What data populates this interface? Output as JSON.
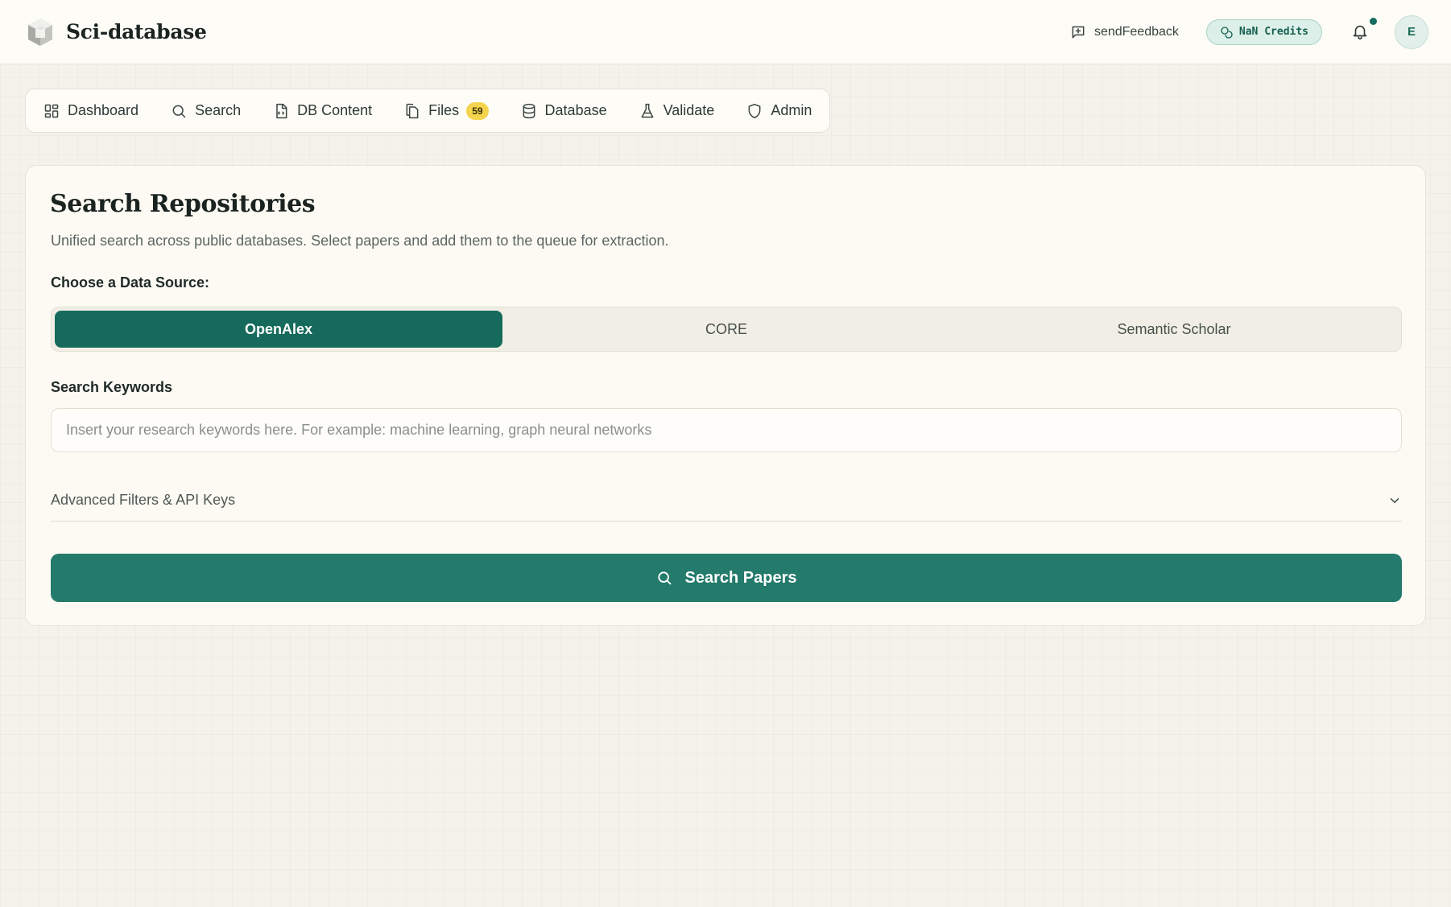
{
  "header": {
    "brand_name": "Sci-database",
    "feedback_label": "sendFeedback",
    "credits_label": "NaN Credits",
    "avatar_initial": "E"
  },
  "nav": {
    "items": [
      {
        "label": "Dashboard",
        "icon": "dashboard-icon"
      },
      {
        "label": "Search",
        "icon": "search-icon"
      },
      {
        "label": "DB Content",
        "icon": "file-code-icon"
      },
      {
        "label": "Files",
        "icon": "files-icon",
        "badge": "59"
      },
      {
        "label": "Database",
        "icon": "database-icon"
      },
      {
        "label": "Validate",
        "icon": "flask-icon"
      },
      {
        "label": "Admin",
        "icon": "shield-icon"
      }
    ]
  },
  "main": {
    "title": "Search Repositories",
    "description": "Unified search across public databases. Select papers and add them to the queue for extraction.",
    "source_label": "Choose a Data Source:",
    "sources": [
      "OpenAlex",
      "CORE",
      "Semantic Scholar"
    ],
    "selected_source": "OpenAlex",
    "keywords_label": "Search Keywords",
    "keywords_value": "",
    "keywords_placeholder": "Insert your research keywords here. For example: machine learning, graph neural networks",
    "advanced_label": "Advanced Filters & API Keys",
    "search_button_label": "Search Papers"
  },
  "colors": {
    "accent": "#156a5c",
    "button": "#247a6b",
    "badge": "#f5d44d",
    "background": "#f4f2ea"
  }
}
